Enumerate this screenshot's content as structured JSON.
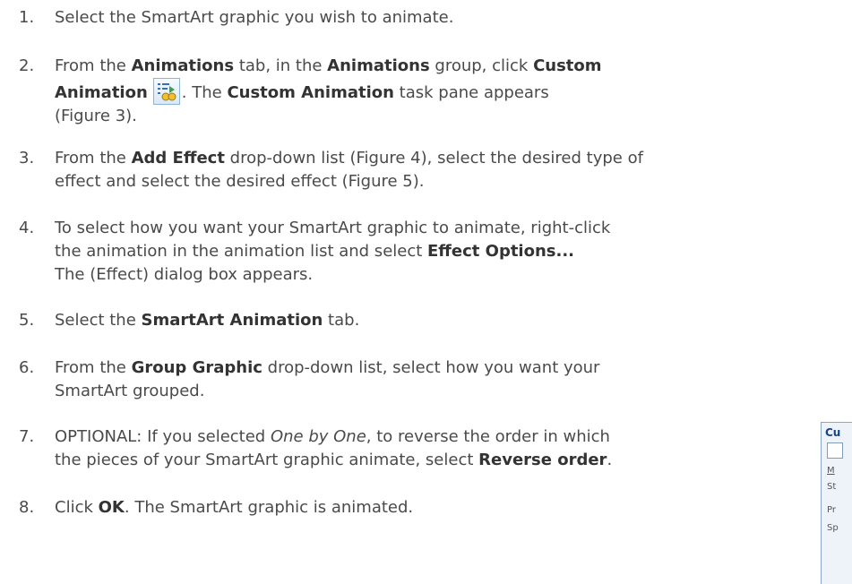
{
  "steps": [
    {
      "num": "1.",
      "line1": [
        "Select the SmartArt graphic you wish to animate."
      ]
    },
    {
      "num": "2.",
      "line1": [
        "From the ",
        "Animations",
        " tab, in the ",
        "Animations",
        " group, click ",
        "Custom"
      ],
      "line2": [
        "Animation",
        ". The ",
        "Custom Animation",
        " task pane appears"
      ],
      "line3": [
        "(Figure 3)."
      ],
      "icon": "custom-animation-icon"
    },
    {
      "num": "3.",
      "line1": [
        "From the ",
        "Add Effect",
        " drop-down list (Figure 4), select the desired type of"
      ],
      "line2": [
        "effect and select the desired effect (Figure 5)."
      ]
    },
    {
      "num": "4.",
      "line1": [
        "To select how you want your SmartArt graphic to animate, right-click"
      ],
      "line2": [
        "the animation in the animation list and select ",
        "Effect Options..."
      ],
      "line3": [
        "The (Effect) dialog box appears."
      ]
    },
    {
      "num": "5.",
      "line1": [
        "Select the ",
        "SmartArt Animation",
        " tab."
      ]
    },
    {
      "num": "6.",
      "line1": [
        "From the ",
        "Group Graphic",
        " drop-down list, select how you want your"
      ],
      "line2": [
        "SmartArt grouped."
      ]
    },
    {
      "num": "7.",
      "line1": [
        "OPTIONAL: If you selected ",
        "One by One",
        ", to reverse the order in which"
      ],
      "line2": [
        "the pieces of your SmartArt graphic animate, select ",
        "Reverse order",
        "."
      ]
    },
    {
      "num": "8.",
      "line1": [
        "Click ",
        "OK",
        ". The SmartArt graphic is animated."
      ]
    }
  ],
  "pane": {
    "title": "Cu",
    "row1": "M",
    "row2": "St",
    "row3": "Pr",
    "row4": "Sp"
  },
  "colors": {
    "text": "#4a4a4a",
    "bold": "#333333",
    "pane_border": "#8aa6c9",
    "pane_title": "#15428b"
  }
}
